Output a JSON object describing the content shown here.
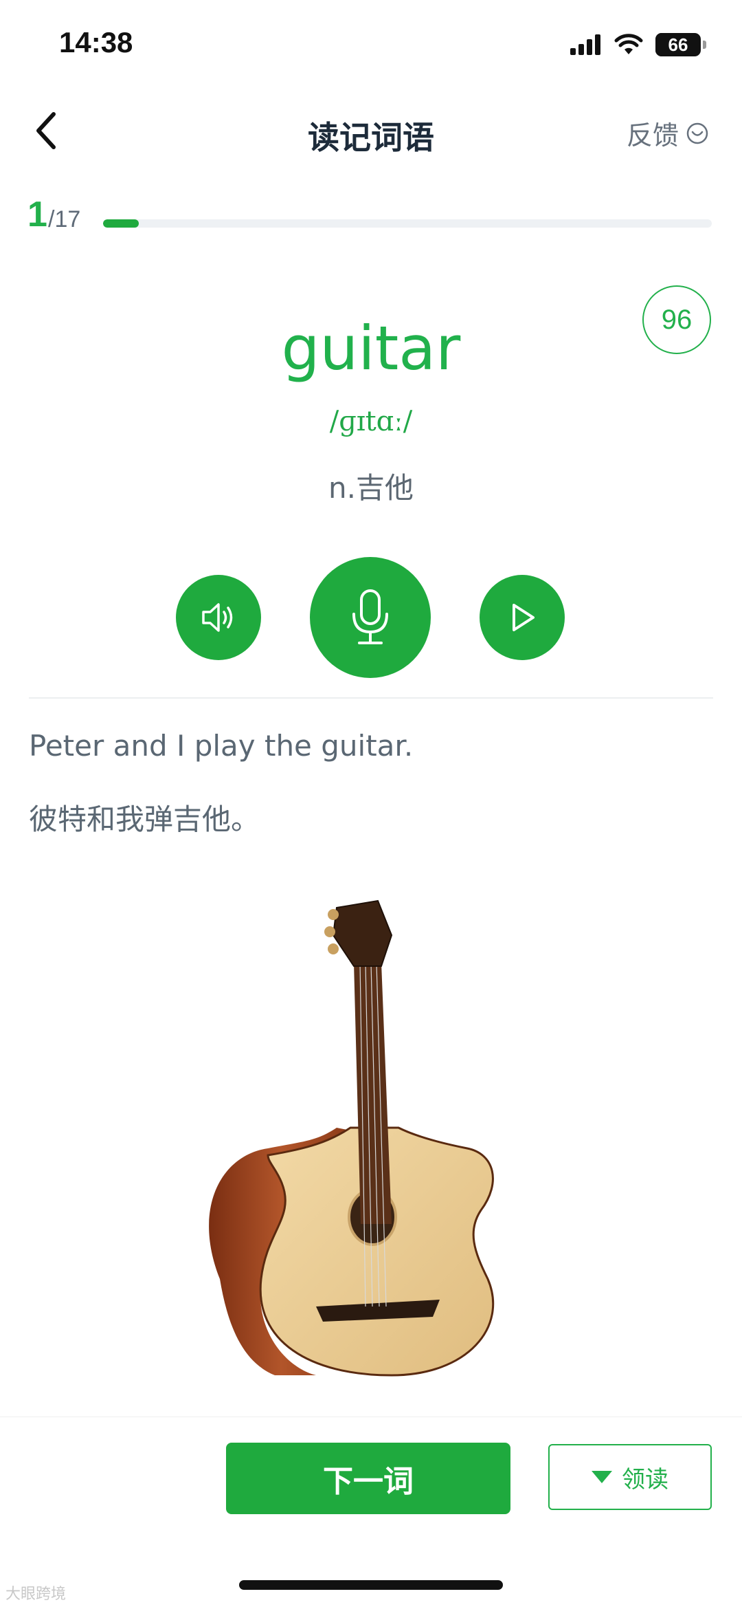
{
  "status_bar": {
    "time": "14:38",
    "battery": "66",
    "battery_level": 0.66,
    "icons": [
      "signal-icon",
      "wifi-icon",
      "battery-icon"
    ]
  },
  "nav": {
    "title": "读记词语",
    "feedback_label": "反馈",
    "icons": [
      "back-chevron-icon",
      "feedback-smile-icon"
    ]
  },
  "progress": {
    "current": "1",
    "total": "/17",
    "fraction": 0.0588
  },
  "score": "96",
  "word": {
    "text": "guitar",
    "phonetic": "/ɡɪtɑː/",
    "meaning": "n.吉他"
  },
  "actions": {
    "icons": [
      "speaker-icon",
      "microphone-icon",
      "play-icon"
    ]
  },
  "sentence": {
    "english": "Peter and I play the guitar.",
    "chinese": "彼特和我弹吉他。"
  },
  "bottom": {
    "next_label": "下一词",
    "follow_read_label": "领读"
  },
  "watermark": "大眼跨境",
  "colors": {
    "accent": "#1faa3e",
    "word": "#21b14c",
    "text_muted": "#5a6773"
  }
}
